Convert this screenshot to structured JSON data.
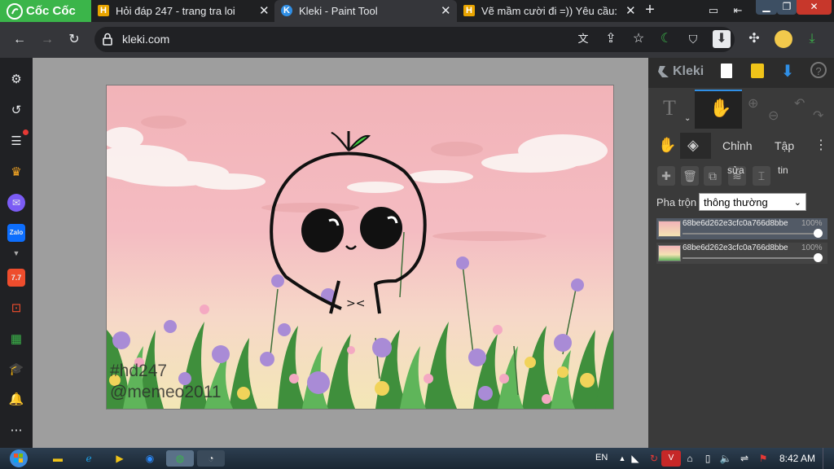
{
  "browser": {
    "brand": "Cốc Cốc",
    "tabs": [
      {
        "title": "Hỏi đáp 247 - trang tra loi",
        "favicon": "H"
      },
      {
        "title": "Kleki - Paint Tool",
        "favicon": "K"
      },
      {
        "title": "Vẽ mầm cười đi =)) Yêu cầu:",
        "favicon": "H"
      }
    ],
    "url": "kleki.com",
    "new_tab_label": "+",
    "close_tab_label": "✕"
  },
  "kleki": {
    "app_name": "Kleki",
    "tool_text_label": "T",
    "tab_adjust_label": "Chỉnh",
    "tab_file_label": "Tập",
    "edit_label": "sửa",
    "file_info_label": "tin",
    "blend_label": "Pha trộn",
    "blend_value": "thông thường",
    "layers": [
      {
        "name": "68be6d262e3cfc0a766d8bbe",
        "opacity": "100%"
      },
      {
        "name": "68be6d262e3cfc0a766d8bbe",
        "opacity": "100%"
      }
    ]
  },
  "canvas": {
    "watermark_line1": "#hd247",
    "watermark_line2": "@memeo2011"
  },
  "taskbar": {
    "language": "EN",
    "time": "8:42 AM"
  },
  "colors": {
    "brand_green": "#3bb54a",
    "accent_blue": "#2f8fe6",
    "sky_pink": "#f2b7bb",
    "leaf_green": "#3fcf3f"
  }
}
